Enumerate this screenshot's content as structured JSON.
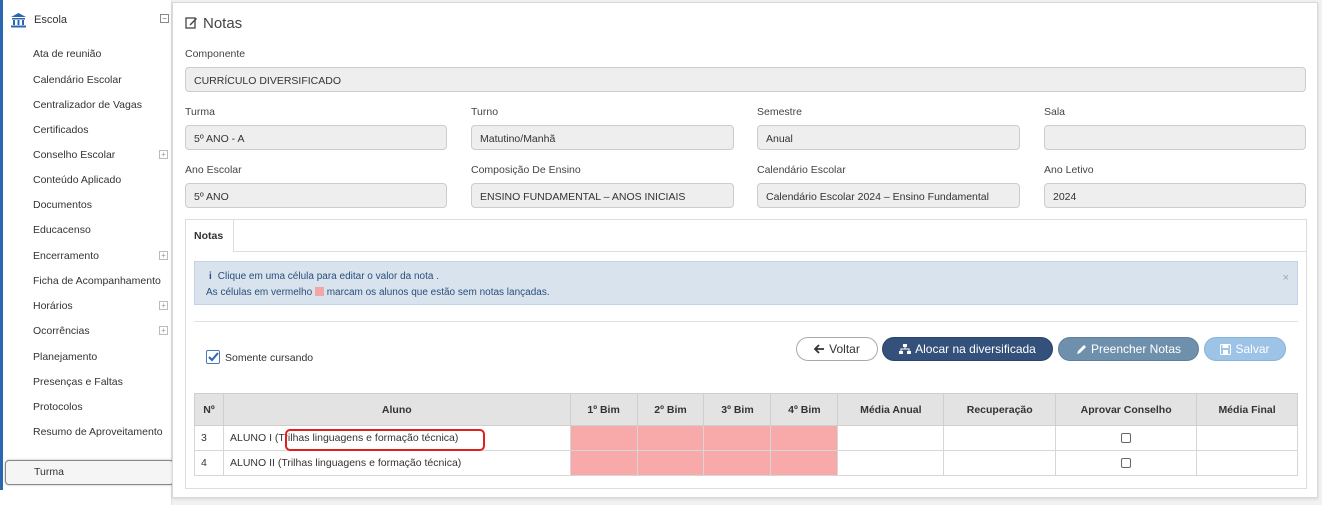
{
  "sidebar": {
    "header": "Escola",
    "items": [
      {
        "label": "Ata de reunião",
        "expand": false
      },
      {
        "label": "Calendário Escolar",
        "expand": false
      },
      {
        "label": "Centralizador de Vagas",
        "expand": false
      },
      {
        "label": "Certificados",
        "expand": false
      },
      {
        "label": "Conselho Escolar",
        "expand": true
      },
      {
        "label": "Conteúdo Aplicado",
        "expand": false
      },
      {
        "label": "Documentos",
        "expand": false
      },
      {
        "label": "Educacenso",
        "expand": false
      },
      {
        "label": "Encerramento",
        "expand": true
      },
      {
        "label": "Ficha de Acompanhamento",
        "expand": false
      },
      {
        "label": "Horários",
        "expand": true
      },
      {
        "label": "Ocorrências",
        "expand": true
      },
      {
        "label": "Planejamento",
        "expand": false
      },
      {
        "label": "Presenças e Faltas",
        "expand": false
      },
      {
        "label": "Protocolos",
        "expand": false
      },
      {
        "label": "Resumo de Aproveitamento",
        "expand": false
      }
    ],
    "active": "Turma"
  },
  "page": {
    "title": "Notas"
  },
  "form": {
    "componente": {
      "label": "Componente",
      "value": "CURRÍCULO DIVERSIFICADO"
    },
    "turma": {
      "label": "Turma",
      "value": "5º ANO - A"
    },
    "turno": {
      "label": "Turno",
      "value": "Matutino/Manhã"
    },
    "semestre": {
      "label": "Semestre",
      "value": "Anual"
    },
    "sala": {
      "label": "Sala",
      "value": ""
    },
    "ano_escolar": {
      "label": "Ano Escolar",
      "value": "5º ANO"
    },
    "composicao": {
      "label": "Composição De Ensino",
      "value": "ENSINO FUNDAMENTAL – ANOS INICIAIS"
    },
    "calendario": {
      "label": "Calendário Escolar",
      "value": "Calendário Escolar 2024 – Ensino Fundamental"
    },
    "ano_letivo": {
      "label": "Ano Letivo",
      "value": "2024"
    }
  },
  "tabs": {
    "notas": "Notas"
  },
  "alert": {
    "line1": "Clique em uma célula para editar o valor da nota .",
    "line2_pre": "As células em vermelho",
    "line2_post": "marcam os alunos que estão sem notas lançadas.",
    "close": "×"
  },
  "filter": {
    "somente_cursando": "Somente cursando",
    "checked": true
  },
  "buttons": {
    "voltar": "Voltar",
    "alocar": "Alocar na diversificada",
    "preencher": "Preencher Notas",
    "salvar": "Salvar"
  },
  "table": {
    "headers": [
      "Nº",
      "Aluno",
      "1º Bim",
      "2º Bim",
      "3º Bim",
      "4º Bim",
      "Média Anual",
      "Recuperação",
      "Aprovar Conselho",
      "Média Final"
    ],
    "rows": [
      {
        "n": "3",
        "aluno": "ALUNO I (Trilhas linguagens e formação técnica)"
      },
      {
        "n": "4",
        "aluno": "ALUNO II (Trilhas linguagens e formação técnica)"
      }
    ]
  },
  "colors": {
    "missing_grade": "#f8a9a9",
    "accent": "#2a67b0",
    "primary_button": "#33517a"
  }
}
